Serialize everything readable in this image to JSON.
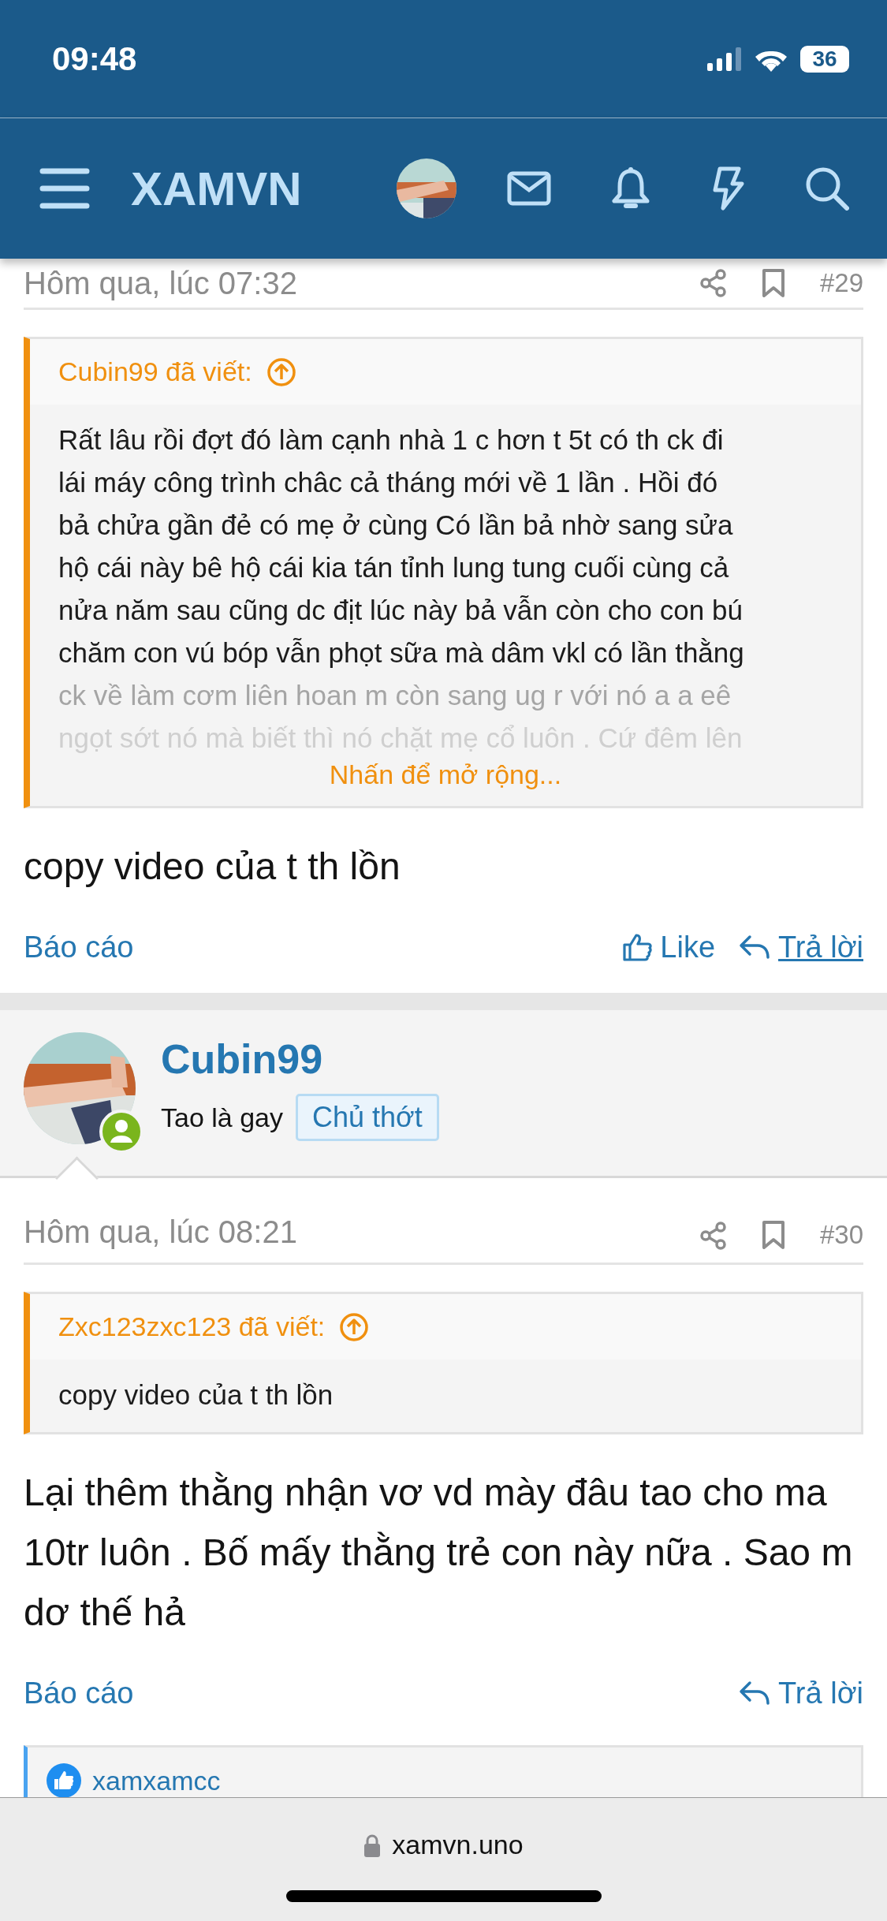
{
  "status_bar": {
    "time": "09:48",
    "battery": "36"
  },
  "header": {
    "logo": "XAMVN"
  },
  "posts": [
    {
      "date": "Hôm qua, lúc 07:32",
      "number": "#29",
      "quote": {
        "author": "Cubin99 đã viết:",
        "collapsed": true,
        "expand": "Nhấn để mở rộng...",
        "lines": [
          "Rất lâu rồi đợt đó làm cạnh nhà 1 c hơn t 5t có th ck đi",
          "lái máy công trình châc cả tháng mới về 1 lần . Hồi đó",
          "bả chửa gần đẻ có mẹ ở cùng Có lần bả nhờ sang sửa",
          "hộ cái này bê hộ cái kia tán tỉnh lung tung cuối cùng cả",
          "nửa năm sau cũng dc địt lúc này bả vẫn còn cho con bú",
          "chăm con vú bóp vẫn phọt sữa mà dâm vkl có lần thằng",
          "ck về làm cơm liên hoan m còn sang ug r với nó a a eê",
          "ngọt sớt nó mà biết thì nó chặt mẹ cổ luôn . Cứ đêm lên"
        ]
      },
      "body": "copy video của t th lồn",
      "actions": [
        {
          "kind": "report",
          "label": "Báo cáo"
        },
        {
          "kind": "like",
          "label": "Like"
        },
        {
          "kind": "reply",
          "label": "Trả lời",
          "underlined": true
        }
      ]
    },
    {
      "author": {
        "name": "Cubin99",
        "title": "Tao là gay",
        "badge": "Chủ thớt",
        "online": true
      },
      "date": "Hôm qua, lúc 08:21",
      "number": "#30",
      "quote": {
        "author": "Zxc123zxc123 đã viết:",
        "collapsed": false,
        "lines": [
          "copy video của t th lồn"
        ]
      },
      "body": "Lại thêm thằng nhận vơ vd mày đâu tao cho ma 10tr luôn . Bố mấy thằng trẻ con này nữa . Sao m dơ thế hả",
      "actions": [
        {
          "kind": "report",
          "label": "Báo cáo"
        },
        {
          "kind": "reply",
          "label": "Trả lời",
          "underlined": false
        }
      ],
      "reactions": {
        "users": "xamxamcc"
      }
    }
  ],
  "browser": {
    "url": "xamvn.uno"
  }
}
